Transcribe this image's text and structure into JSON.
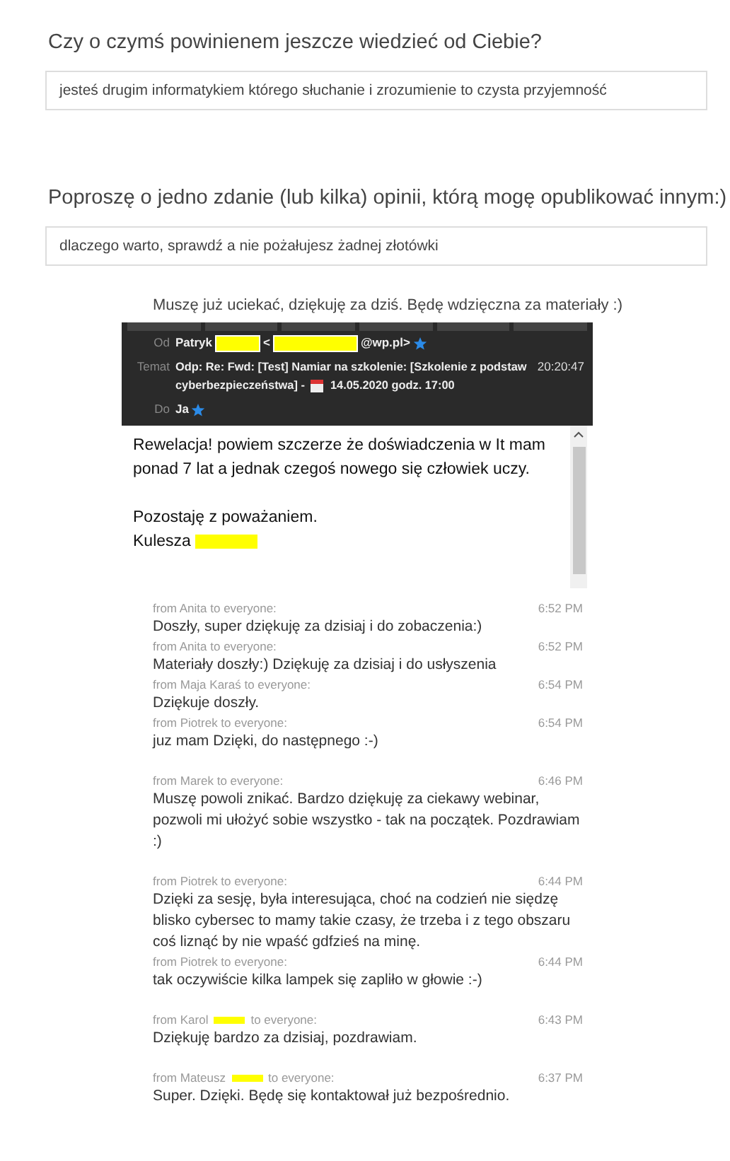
{
  "survey": [
    {
      "question": "Czy o czymś powinienem jeszcze wiedzieć od Ciebie?",
      "answer": "jesteś drugim informatykiem którego słuchanie i zrozumienie to czysta przyjemność"
    },
    {
      "question": "Poproszę o jedno zdanie (lub kilka) opinii, którą mogę opublikować innym:)",
      "answer": "dlaczego warto, sprawdź a nie pożałujesz żadnej złotówki"
    }
  ],
  "quote": "Muszę już uciekać, dziękuję za dziś. Będę wdzięczna za materiały :)",
  "email": {
    "from_label": "Od",
    "from_name": "Patryk",
    "from_open": "<",
    "from_domain": "@wp.pl>",
    "subject_label": "Temat",
    "subject": [
      "Odp: Re: Fwd: [Test] Namiar na szkolenie: [Szkolenie z podstaw",
      "cyberbezpieczeństwa] -"
    ],
    "subject_date": "14.05.2020 godz. 17:00",
    "time": "20:20:47",
    "to_label": "Do",
    "to": "Ja",
    "body": [
      "Rewelacja! powiem szczerze że doświadczenia w It mam ponad 7 lat a jednak czegoś nowego się człowiek uczy.",
      "Pozostaję z poważaniem.",
      "Kulesza"
    ]
  },
  "chat": [
    [
      {
        "from": "from Anita to everyone:",
        "time": "6:52 PM",
        "text": "Doszły, super dziękuję za dzisiaj i do zobaczenia:)"
      },
      {
        "from": "from Anita to everyone:",
        "time": "6:52 PM",
        "text": "Materiały doszły:) Dziękuję za dzisiaj i do usłyszenia"
      },
      {
        "from": "from Maja Karaś to everyone:",
        "time": "6:54 PM",
        "text": "Dziękuje doszły."
      },
      {
        "from": "from Piotrek to everyone:",
        "time": "6:54 PM",
        "text": "juz mam Dzięki, do następnego :-)"
      }
    ],
    [
      {
        "from": "from Marek to everyone:",
        "time": "6:46 PM",
        "text": "Muszę powoli znikać. Bardzo dziękuję za ciekawy webinar, pozwoli mi ułożyć sobie wszystko - tak na początek. Pozdrawiam :)"
      }
    ],
    [
      {
        "from": "from Piotrek to everyone:",
        "time": "6:44 PM",
        "text": "Dzięki za sesję, była interesująca, choć na codzień nie siędzę blisko cybersec to mamy takie czasy, że trzeba i z tego obszaru coś liznąć by nie wpaść gdfzieś na minę."
      },
      {
        "from": "from Piotrek to everyone:",
        "time": "6:44 PM",
        "text": "tak oczywiście kilka lampek się zapliło w głowie :-)"
      }
    ],
    [
      {
        "from": "from Karol",
        "from_after": "to everyone:",
        "time": "6:43 PM",
        "text": "Dziękuję bardzo za dzisiaj, pozdrawiam."
      }
    ],
    [
      {
        "from": "from Mateusz",
        "from_after": "to everyone:",
        "time": "6:37 PM",
        "text": "Super. Dzięki. Będę się kontaktował już bezpośrednio."
      }
    ]
  ]
}
